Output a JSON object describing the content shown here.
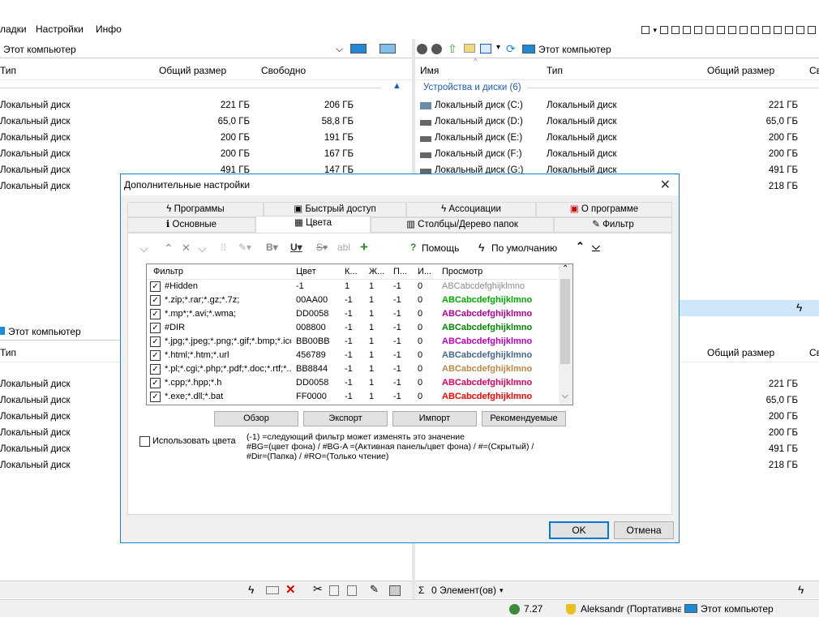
{
  "menu": {
    "items": [
      "ладки",
      "Настройки",
      "Инфо"
    ]
  },
  "left_pane": {
    "address": "Этот компьютер",
    "columns": [
      "Тип",
      "Общий размер",
      "Свободно"
    ],
    "rows": [
      {
        "type": "Локальный диск",
        "total": "221 ГБ",
        "free": "206 ГБ"
      },
      {
        "type": "Локальный диск",
        "total": "65,0 ГБ",
        "free": "58,8 ГБ"
      },
      {
        "type": "Локальный диск",
        "total": "200 ГБ",
        "free": "191 ГБ"
      },
      {
        "type": "Локальный диск",
        "total": "200 ГБ",
        "free": "167 ГБ"
      },
      {
        "type": "Локальный диск",
        "total": "491 ГБ",
        "free": "147 ГБ"
      },
      {
        "type": "Локальный диск",
        "total": "",
        "free": ""
      }
    ]
  },
  "right_pane": {
    "address": "Этот компьютер",
    "columns": [
      "Имя",
      "Тип",
      "Общий размер",
      "Св"
    ],
    "group": "Устройства и диски (6)",
    "rows": [
      {
        "name": "Локальный диск (C:)",
        "type": "Локальный диск",
        "total": "221 ГБ"
      },
      {
        "name": "Локальный диск (D:)",
        "type": "Локальный диск",
        "total": "65,0 ГБ"
      },
      {
        "name": "Локальный диск (E:)",
        "type": "Локальный диск",
        "total": "200 ГБ"
      },
      {
        "name": "Локальный диск (F:)",
        "type": "Локальный диск",
        "total": "200 ГБ"
      },
      {
        "name": "Локальный диск (G:)",
        "type": "Локальный диск",
        "total": "491 ГБ"
      },
      {
        "name": "",
        "type": "",
        "total": "218 ГБ"
      }
    ]
  },
  "bottom_left_pane": {
    "address": "Этот компьютер",
    "columns": [
      "Тип"
    ],
    "rows": [
      "Локальный диск",
      "Локальный диск",
      "Локальный диск",
      "Локальный диск",
      "Локальный диск",
      "Локальный диск"
    ]
  },
  "bottom_right_pane": {
    "columns": [
      "Общий размер",
      "Св"
    ],
    "rows": [
      "221 ГБ",
      "65,0 ГБ",
      "200 ГБ",
      "200 ГБ",
      "491 ГБ",
      "218 ГБ"
    ]
  },
  "dialog": {
    "title": "Дополнительные настройки",
    "tabs_row1": [
      "Программы",
      "Быстрый доступ",
      "Ассоциации",
      "О программе"
    ],
    "tabs_row2": [
      "Основные",
      "Цвета",
      "Столбцы/Дерево папок",
      "Фильтр"
    ],
    "toolbar": {
      "help": "Помощь",
      "default": "По умолчанию"
    },
    "grid_columns": [
      "Фильтр",
      "Цвет",
      "К...",
      "Ж...",
      "П...",
      "И...",
      "Просмотр"
    ],
    "grid_rows": [
      {
        "filter": "#Hidden",
        "color": "-1",
        "k": "1",
        "zh": "1",
        "p": "-1",
        "i": "0",
        "preview": "ABCabcdefghijklmno",
        "preview_color": "#8c8c8c",
        "bold": false
      },
      {
        "filter": "*.zip;*.rar;*.gz;*.7z;",
        "color": "00AA00",
        "k": "-1",
        "zh": "1",
        "p": "-1",
        "i": "0",
        "preview": "ABCabcdefghijklmno",
        "preview_color": "#00aa00",
        "bold": true
      },
      {
        "filter": "*.mp*;*.avi;*.wma;",
        "color": "DD0058",
        "k": "-1",
        "zh": "1",
        "p": "-1",
        "i": "0",
        "preview": "ABCabcdefghijklmno",
        "preview_color": "#b00090",
        "bold": true
      },
      {
        "filter": "#DIR",
        "color": "008800",
        "k": "-1",
        "zh": "1",
        "p": "-1",
        "i": "0",
        "preview": "ABCabcdefghijklmno",
        "preview_color": "#008800",
        "bold": true
      },
      {
        "filter": "*.jpg;*.jpeg;*.png;*.gif;*.bmp;*.ico",
        "color": "BB00BB",
        "k": "-1",
        "zh": "1",
        "p": "-1",
        "i": "0",
        "preview": "ABCabcdefghijklmno",
        "preview_color": "#bb00bb",
        "bold": true
      },
      {
        "filter": "*.html;*.htm;*.url",
        "color": "456789",
        "k": "-1",
        "zh": "1",
        "p": "-1",
        "i": "0",
        "preview": "ABCabcdefghijklmno",
        "preview_color": "#456789",
        "bold": true
      },
      {
        "filter": "*.pl;*.cgi;*.php;*.pdf;*.doc;*.rtf;*...",
        "color": "BB8844",
        "k": "-1",
        "zh": "1",
        "p": "-1",
        "i": "0",
        "preview": "ABCabcdefghijklmno",
        "preview_color": "#bb8844",
        "bold": true
      },
      {
        "filter": "*.cpp;*.hpp;*.h",
        "color": "DD0058",
        "k": "-1",
        "zh": "1",
        "p": "-1",
        "i": "0",
        "preview": "ABCabcdefghijklmno",
        "preview_color": "#dd0058",
        "bold": true
      },
      {
        "filter": "*.exe;*.dll;*.bat",
        "color": "FF0000",
        "k": "-1",
        "zh": "1",
        "p": "-1",
        "i": "0",
        "preview": "ABCabcdefghijklmno",
        "preview_color": "#ff0000",
        "bold": true
      }
    ],
    "buttons": {
      "browse": "Обзор",
      "export": "Экспорт",
      "import": "Импорт",
      "recommended": "Рекомендуемые"
    },
    "use_colors_label": "Использовать цвета",
    "note_lines": [
      "(-1) =следующий фильтр может изменять это значение",
      "#BG=(цвет фона) / #BG-A =(Активная панель/цвет фона) / #=(Скрытый) /",
      "#Dir=(Папка) / #RO=(Только чтение)"
    ],
    "ok": "OK",
    "cancel": "Отмена"
  },
  "status": {
    "items": "0 Элемент(ов)",
    "version": "7.27",
    "user": "Aleksandr (Портативна",
    "computer": "Этот компьютер"
  }
}
